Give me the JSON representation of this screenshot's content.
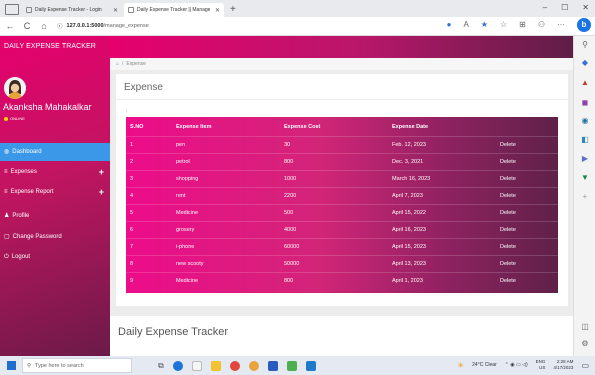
{
  "browser": {
    "tabs": [
      {
        "label": "Daily Expense Tracker - Login"
      },
      {
        "label": "Daily Expense Tracker || Manage"
      }
    ],
    "url_host": "127.0.0.1:5000",
    "url_path": "/manage_expense",
    "new_tab_label": "+",
    "window_controls": [
      "–",
      "☐",
      "✕"
    ],
    "nav_icons": [
      "←",
      "C",
      "⌂",
      "ⓘ"
    ],
    "tool_icons": [
      "●",
      "A",
      "★",
      "☆",
      "⊞",
      "⚇",
      "···"
    ],
    "bing_label": "b"
  },
  "app": {
    "brand": "DAILY EXPENSE TRACKER",
    "user": {
      "name": "Akanksha Mahakalkar",
      "status": "ONLINE"
    },
    "menu": [
      {
        "label": "Dashboard",
        "icon": "dashboard-icon",
        "active": true
      },
      {
        "label": "Expenses",
        "icon": "list-icon",
        "expandable": "+"
      },
      {
        "label": "Expense Report",
        "icon": "list-icon",
        "expandable": "+"
      },
      {
        "label": "Profile",
        "icon": "user-icon"
      },
      {
        "label": "Change Password",
        "icon": "clipboard-icon"
      },
      {
        "label": "Logout",
        "icon": "power-icon"
      }
    ],
    "breadcrumb": "Expense",
    "panel_title": "Expense",
    "panel_mark": "•",
    "table": {
      "headers": [
        "S.NO",
        "Expense Item",
        "Expense Cost",
        "Expense Date",
        ""
      ],
      "rows": [
        {
          "sno": "1",
          "item": "pen",
          "cost": "30",
          "date": "Feb. 12, 2023",
          "action": "Delete"
        },
        {
          "sno": "2",
          "item": "petrol",
          "cost": "800",
          "date": "Dec. 3, 2021",
          "action": "Delete"
        },
        {
          "sno": "3",
          "item": "shopping",
          "cost": "1000",
          "date": "March 16, 2023",
          "action": "Delete"
        },
        {
          "sno": "4",
          "item": "rent",
          "cost": "2200",
          "date": "April 7, 2023",
          "action": "Delete"
        },
        {
          "sno": "5",
          "item": "Medicine",
          "cost": "500",
          "date": "April 15, 2022",
          "action": "Delete"
        },
        {
          "sno": "6",
          "item": "grosery",
          "cost": "4000",
          "date": "April 16, 2023",
          "action": "Delete"
        },
        {
          "sno": "7",
          "item": "i-phone",
          "cost": "60000",
          "date": "April 15, 2023",
          "action": "Delete"
        },
        {
          "sno": "8",
          "item": "new scooty",
          "cost": "50000",
          "date": "April 13, 2023",
          "action": "Delete"
        },
        {
          "sno": "9",
          "item": "Medicine",
          "cost": "800",
          "date": "April 1, 2023",
          "action": "Delete"
        }
      ]
    },
    "footer_title": "Daily Expense Tracker"
  },
  "taskbar": {
    "search_placeholder": "Type here to search",
    "weather": "24°C Clear",
    "lang_top": "ENG",
    "lang_bottom": "US",
    "time": "2:28 AM",
    "date": "4/17/2023"
  },
  "colors": {
    "accent_pink": "#e6006e",
    "accent_plum": "#5e1e46",
    "active_blue": "#3b97e8"
  }
}
